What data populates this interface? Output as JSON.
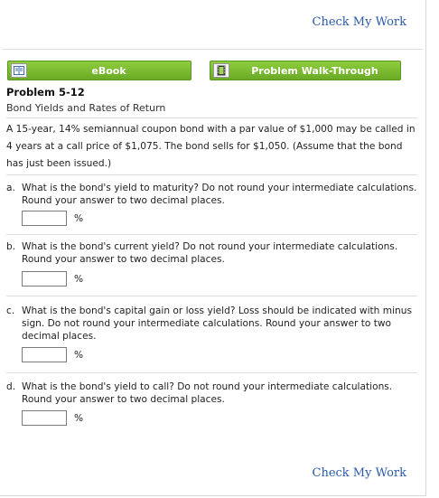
{
  "check_my_work_label": "Check My Work",
  "buttons": {
    "ebook_label": "eBook",
    "walkthrough_label": "Problem Walk-Through",
    "ebook_icon": "book-icon",
    "walkthrough_icon": "film-icon",
    "accent_color": "#79b82f"
  },
  "problem": {
    "title": "Problem 5-12",
    "subtitle": "Bond Yields and Rates of Return",
    "intro": "A 15-year, 14% semiannual coupon bond with a par value of $1,000 may be called in 4 years at a call price of $1,075. The bond sells for $1,050. (Assume that the bond has just been issued.)"
  },
  "questions": [
    {
      "label": "a.",
      "text": "What is the bond's yield to maturity? Do not round your intermediate calculations. Round your answer to two decimal places.",
      "value": "",
      "unit": "%"
    },
    {
      "label": "b.",
      "text": "What is the bond's current yield? Do not round your intermediate calculations. Round your answer to two decimal places.",
      "value": "",
      "unit": "%"
    },
    {
      "label": "c.",
      "text": "What is the bond's capital gain or loss yield? Loss should be indicated with minus sign. Do not round your intermediate calculations. Round your answer to two decimal places.",
      "value": "",
      "unit": "%"
    },
    {
      "label": "d.",
      "text": "What is the bond's yield to call? Do not round your intermediate calculations. Round your answer to two decimal places.",
      "value": "",
      "unit": "%"
    }
  ]
}
